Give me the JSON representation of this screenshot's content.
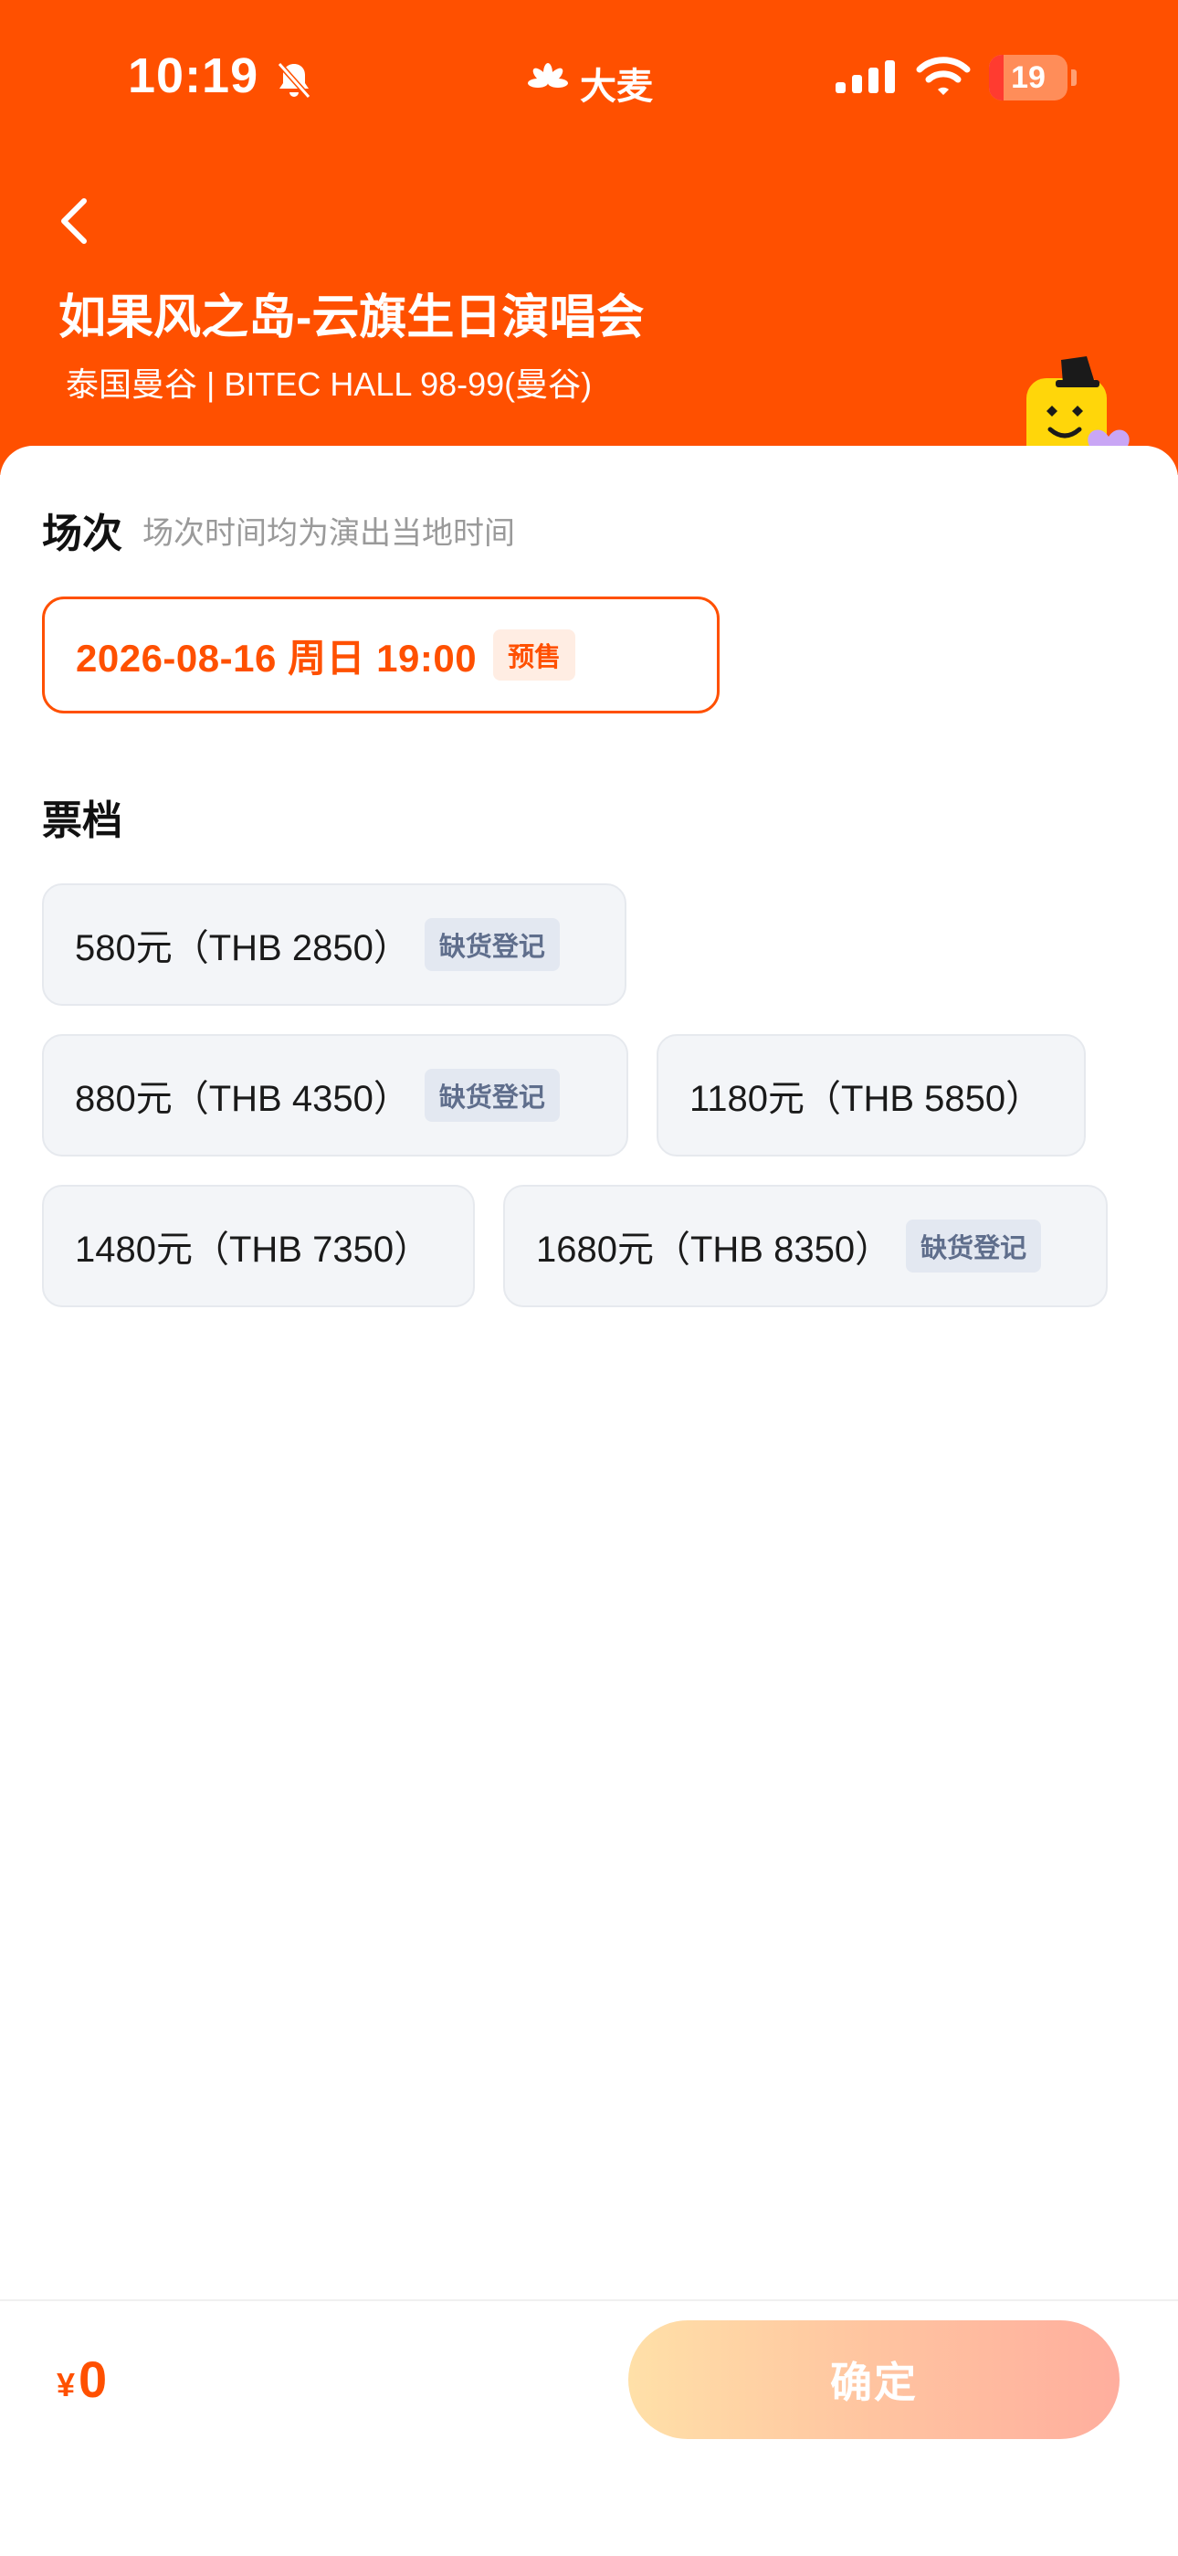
{
  "status_bar": {
    "time": "10:19",
    "brand_name": "大麦",
    "battery_level": "19",
    "battery_fraction": 0.19,
    "icons": [
      "bell-slash-icon",
      "damai-logo-icon",
      "cellular-signal-icon",
      "wifi-icon",
      "battery-icon"
    ]
  },
  "header": {
    "title": "如果风之岛-云旗生日演唱会",
    "venue": "泰国曼谷 | BITEC HALL 98-99(曼谷)",
    "back_icon": "chevron-left-icon"
  },
  "session_section": {
    "title": "场次",
    "subtitle": "场次时间均为演出当地时间",
    "selected_session": {
      "label": "2026-08-16  周日 19:00",
      "badge": "预售"
    }
  },
  "tier_section": {
    "title": "票档",
    "tiers": [
      {
        "label": "580元（THB 2850）",
        "badge": "缺货登记"
      },
      {
        "label": "880元（THB 4350）",
        "badge": "缺货登记"
      },
      {
        "label": "1180元（THB 5850）",
        "badge": ""
      },
      {
        "label": "1480元（THB 7350）",
        "badge": ""
      },
      {
        "label": "1680元（THB 8350）",
        "badge": "缺货登记"
      }
    ]
  },
  "footer": {
    "currency": "¥",
    "total": "0",
    "confirm_label": "确定"
  },
  "colors": {
    "brand": "#FF5000",
    "tier_background": "#F3F5F8",
    "badge_text": "#5F6E8C"
  }
}
